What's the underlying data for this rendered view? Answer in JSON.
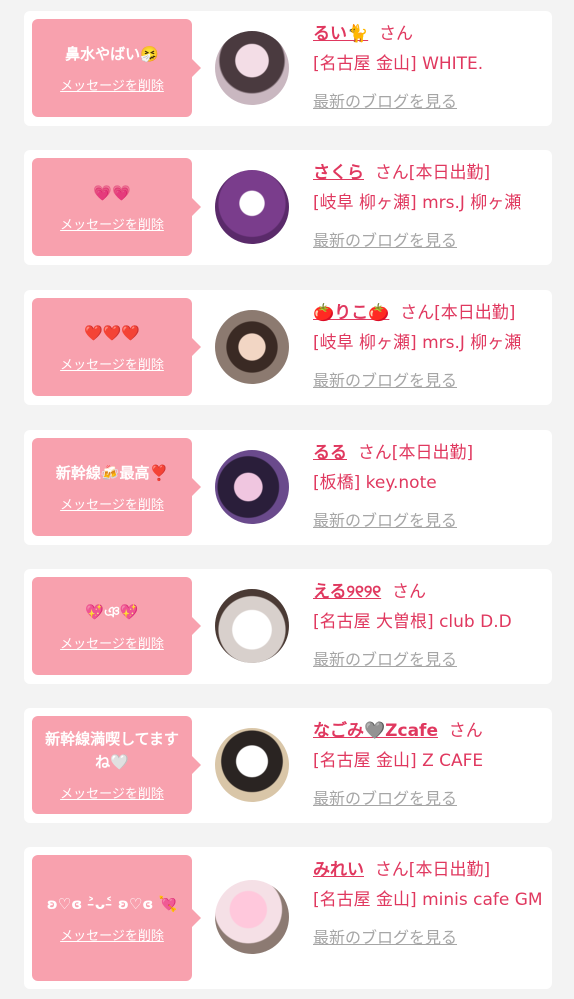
{
  "delete_label": "メッセージを削除",
  "blog_label": "最新のブログを見る",
  "colors": {
    "accent": "#e0385f",
    "bubble": "#f8a1ae",
    "card": "#ffffff",
    "background": "#f3f3f3",
    "blog_link": "#a6a6a6"
  },
  "items": [
    {
      "message": "鼻水やばい🤧",
      "name": "るい🐈",
      "suffix": "さん",
      "shop": "[名古屋 金山] WHITE."
    },
    {
      "message": "💗💗",
      "name": "さくら",
      "suffix": "さん[本日出勤]",
      "shop": "[岐阜 柳ヶ瀬] mrs.J 柳ヶ瀬"
    },
    {
      "message": "❤️❤️❤️",
      "name": "🍅りこ🍅",
      "suffix": "さん[本日出勤]",
      "shop": "[岐阜 柳ヶ瀬] mrs.J 柳ヶ瀬"
    },
    {
      "message": "新幹線🍻最高❣️",
      "name": "るる",
      "suffix": "さん[本日出勤]",
      "shop": "[板橋] key.note"
    },
    {
      "message": "💖ঞ💖",
      "name": "える୨୧୨୧",
      "suffix": "さん",
      "shop": "[名古屋 大曽根] club D.D"
    },
    {
      "message": "新幹線満喫してますね🤍",
      "name": "なごみ🩶Zcafe",
      "suffix": "さん",
      "shop": "[名古屋 金山] Z CAFE"
    },
    {
      "message": "ʚ♡ɞ ˃̵ᴗ˂̵ ʚ♡ɞ 💘",
      "name": "みれい",
      "suffix": "さん[本日出勤]",
      "shop": "[名古屋 金山] minis cafe GM"
    }
  ]
}
